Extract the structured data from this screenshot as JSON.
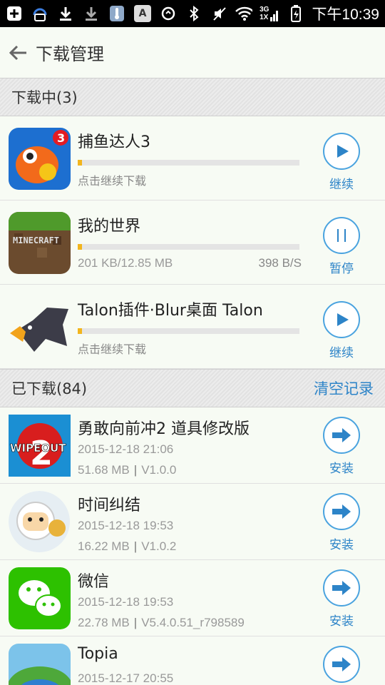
{
  "status_bar": {
    "time": "下午10:39",
    "network": "3G",
    "network2": "1X",
    "letter_box": "A"
  },
  "header": {
    "title": "下载管理"
  },
  "downloading": {
    "title": "下载中(3)",
    "items": [
      {
        "name": "捕鱼达人3",
        "progress": 0.02,
        "status": "点击继续下载",
        "speed": "",
        "action": "继续",
        "action_icon": "play-icon"
      },
      {
        "name": "我的世界",
        "progress": 0.02,
        "status": "201 KB/12.85 MB",
        "speed": "398 B/S",
        "action": "暂停",
        "action_icon": "pause-icon"
      },
      {
        "name": "Talon插件·Blur桌面 Talon",
        "progress": 0.02,
        "status": "点击继续下载",
        "speed": "",
        "action": "继续",
        "action_icon": "play-icon"
      }
    ]
  },
  "downloaded": {
    "title": "已下载(84)",
    "clear_label": "清空记录",
    "items": [
      {
        "name": "勇敢向前冲2 道具修改版",
        "date": "2015-12-18 21:06",
        "size": "51.68 MB",
        "version": "V1.0.0",
        "action": "安装"
      },
      {
        "name": "时间纠结",
        "date": "2015-12-18 19:53",
        "size": "16.22 MB",
        "version": "V1.0.2",
        "action": "安装"
      },
      {
        "name": "微信",
        "date": "2015-12-18 19:53",
        "size": "22.78 MB",
        "version": "V5.4.0.51_r798589",
        "action": "安装"
      },
      {
        "name": "Topia",
        "date": "2015-12-17 20:55",
        "size": "",
        "version": "",
        "action": ""
      }
    ]
  },
  "colors": {
    "accent": "#2d84c8",
    "progress": "#f2b51d",
    "background": "#f7fbf4"
  }
}
